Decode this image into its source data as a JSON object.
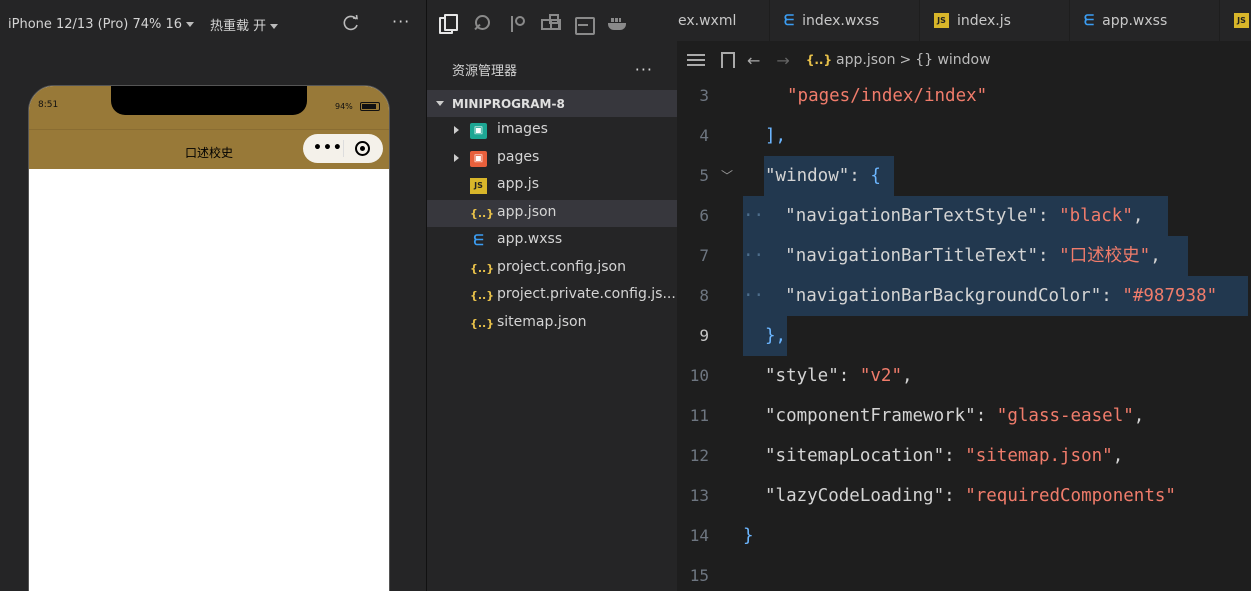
{
  "simulator": {
    "device_label": "iPhone 12/13 (Pro) 74% 16",
    "hot_reload_label": "热重载 开",
    "more": "···",
    "status_time": "8:51",
    "battery_text": "94%",
    "nav_title": "口述校史",
    "capsule_dots": "•••",
    "nav_bg_color": "#987938"
  },
  "explorer": {
    "title": "资源管理器",
    "more": "···",
    "folder": "MINIPROGRAM-8",
    "items": [
      {
        "label": "images",
        "icon": "folder-images-icon",
        "folder": true
      },
      {
        "label": "pages",
        "icon": "folder-pages-icon",
        "folder": true
      },
      {
        "label": "app.js",
        "icon": "js-file-icon",
        "folder": false
      },
      {
        "label": "app.json",
        "icon": "json-file-icon",
        "folder": false,
        "selected": true
      },
      {
        "label": "app.wxss",
        "icon": "css-file-icon",
        "folder": false
      },
      {
        "label": "project.config.json",
        "icon": "json-file-icon",
        "folder": false
      },
      {
        "label": "project.private.config.js...",
        "icon": "json-file-icon",
        "folder": false
      },
      {
        "label": "sitemap.json",
        "icon": "json-file-icon",
        "folder": false
      }
    ]
  },
  "editor": {
    "tabs": [
      {
        "label": "ex.wxml",
        "icon": ""
      },
      {
        "label": "index.wxss",
        "icon": "css"
      },
      {
        "label": "index.js",
        "icon": "js"
      },
      {
        "label": "app.wxss",
        "icon": "css"
      }
    ],
    "breadcrumb": {
      "file": "app.json",
      "sep": ">",
      "symbol": "{} window"
    },
    "lines": [
      {
        "n": "3"
      },
      {
        "n": "4"
      },
      {
        "n": "5"
      },
      {
        "n": "6"
      },
      {
        "n": "7"
      },
      {
        "n": "8"
      },
      {
        "n": "9"
      },
      {
        "n": "10"
      },
      {
        "n": "11"
      },
      {
        "n": "12"
      },
      {
        "n": "13"
      },
      {
        "n": "14"
      },
      {
        "n": "15"
      }
    ],
    "code": {
      "l3": "\"pages/index/index\"",
      "l4": "],",
      "l5_key": "\"window\"",
      "l6_key": "\"navigationBarTextStyle\"",
      "l6_val": "\"black\"",
      "l7_key": "\"navigationBarTitleText\"",
      "l7_val": "\"口述校史\"",
      "l8_key": "\"navigationBarBackgroundColor\"",
      "l8_val": "\"#987938\"",
      "l9": "},",
      "l10_key": "\"style\"",
      "l10_val": "\"v2\"",
      "l11_key": "\"componentFramework\"",
      "l11_val": "\"glass-easel\"",
      "l12_key": "\"sitemapLocation\"",
      "l12_val": "\"sitemap.json\"",
      "l13_key": "\"lazyCodeLoading\"",
      "l13_val": "\"requiredComponents\"",
      "l14": "}"
    }
  }
}
